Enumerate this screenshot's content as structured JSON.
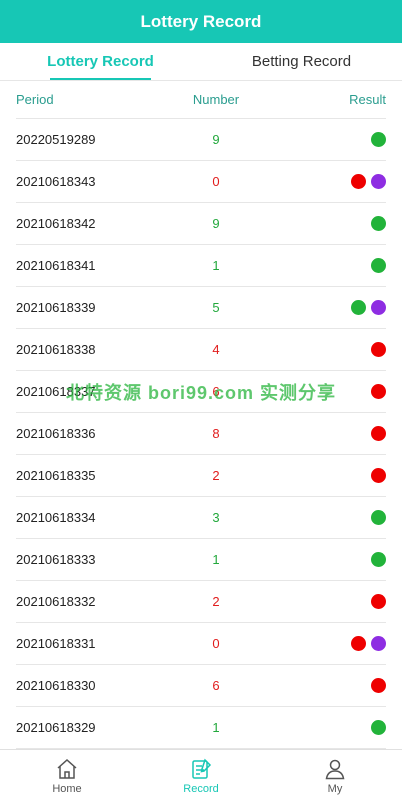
{
  "header": {
    "title": "Lottery Record"
  },
  "tabs": [
    {
      "label": "Lottery Record",
      "active": true
    },
    {
      "label": "Betting Record",
      "active": false
    }
  ],
  "columns": {
    "period": "Period",
    "number": "Number",
    "result": "Result"
  },
  "colors": {
    "green": "#22b33a",
    "red": "#ee0000",
    "purple": "#8e2de2",
    "accent": "#17c7b5"
  },
  "rows": [
    {
      "period": "20220519289",
      "number": "9",
      "num_color": "green",
      "result": [
        "green"
      ]
    },
    {
      "period": "20210618343",
      "number": "0",
      "num_color": "red",
      "result": [
        "red",
        "purple"
      ]
    },
    {
      "period": "20210618342",
      "number": "9",
      "num_color": "green",
      "result": [
        "green"
      ]
    },
    {
      "period": "20210618341",
      "number": "1",
      "num_color": "green",
      "result": [
        "green"
      ]
    },
    {
      "period": "20210618339",
      "number": "5",
      "num_color": "green",
      "result": [
        "green",
        "purple"
      ]
    },
    {
      "period": "20210618338",
      "number": "4",
      "num_color": "red",
      "result": [
        "red"
      ]
    },
    {
      "period": "20210618337",
      "number": "6",
      "num_color": "red",
      "result": [
        "red"
      ]
    },
    {
      "period": "20210618336",
      "number": "8",
      "num_color": "red",
      "result": [
        "red"
      ]
    },
    {
      "period": "20210618335",
      "number": "2",
      "num_color": "red",
      "result": [
        "red"
      ]
    },
    {
      "period": "20210618334",
      "number": "3",
      "num_color": "green",
      "result": [
        "green"
      ]
    },
    {
      "period": "20210618333",
      "number": "1",
      "num_color": "green",
      "result": [
        "green"
      ]
    },
    {
      "period": "20210618332",
      "number": "2",
      "num_color": "red",
      "result": [
        "red"
      ]
    },
    {
      "period": "20210618331",
      "number": "0",
      "num_color": "red",
      "result": [
        "red",
        "purple"
      ]
    },
    {
      "period": "20210618330",
      "number": "6",
      "num_color": "red",
      "result": [
        "red"
      ]
    },
    {
      "period": "20210618329",
      "number": "1",
      "num_color": "green",
      "result": [
        "green"
      ]
    }
  ],
  "watermark": "北特资源  bori99.com  实测分享",
  "tabbar": [
    {
      "label": "Home",
      "icon": "home-icon",
      "active": false
    },
    {
      "label": "Record",
      "icon": "record-icon",
      "active": true
    },
    {
      "label": "My",
      "icon": "user-icon",
      "active": false
    }
  ]
}
